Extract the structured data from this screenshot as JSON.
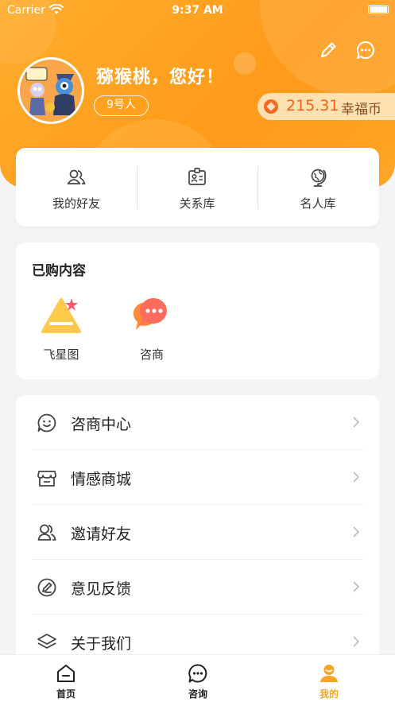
{
  "status_bar": {
    "carrier": "Carrier",
    "time": "9:37 AM"
  },
  "profile": {
    "greeting": "猕猴桃，您好！",
    "tag": "9号人",
    "balance_value": "215.31",
    "balance_unit": "幸福币"
  },
  "quick_nav": [
    {
      "label": "我的好友",
      "icon": "friends-icon"
    },
    {
      "label": "关系库",
      "icon": "contact-card-icon"
    },
    {
      "label": "名人库",
      "icon": "globe-icon"
    }
  ],
  "purchased": {
    "title": "已购内容",
    "items": [
      {
        "label": "飞星图",
        "icon": "star-chart-icon"
      },
      {
        "label": "咨商",
        "icon": "consult-bubble-icon"
      }
    ]
  },
  "menu": [
    {
      "label": "咨商中心",
      "icon": "smile-chat-icon"
    },
    {
      "label": "情感商城",
      "icon": "store-icon"
    },
    {
      "label": "邀请好友",
      "icon": "invite-icon"
    },
    {
      "label": "意见反馈",
      "icon": "feedback-pen-icon"
    },
    {
      "label": "关于我们",
      "icon": "layers-icon"
    }
  ],
  "tabs": [
    {
      "label": "首页",
      "icon": "home-icon",
      "active": false
    },
    {
      "label": "咨询",
      "icon": "chat-bubble-icon",
      "active": false
    },
    {
      "label": "我的",
      "icon": "user-icon",
      "active": true
    }
  ],
  "colors": {
    "accent": "#ff9a1a",
    "active_tab": "#f5a623",
    "coin": "#f25f18"
  }
}
